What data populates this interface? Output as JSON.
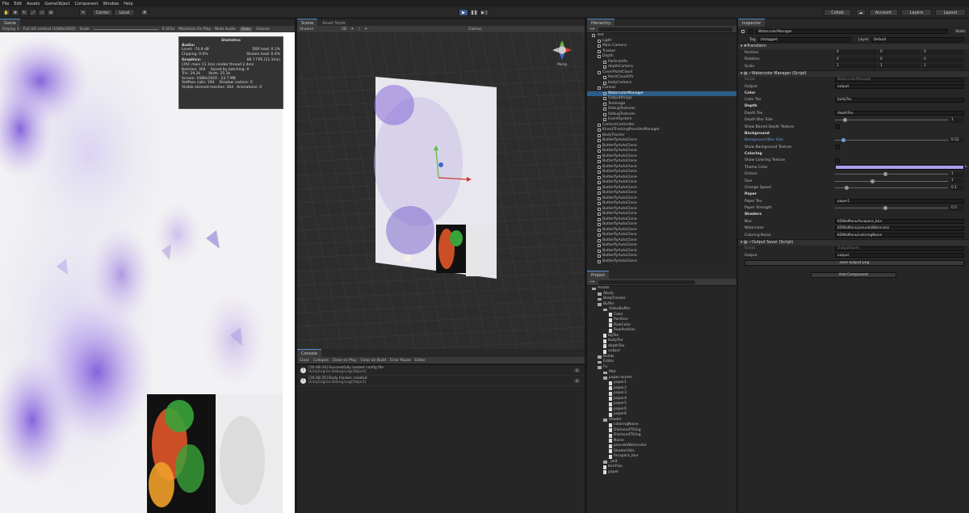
{
  "menu": [
    "File",
    "Edit",
    "Assets",
    "GameObject",
    "Component",
    "Window",
    "Help"
  ],
  "toolbar": {
    "pivot": "Center",
    "space": "Local",
    "collab": "Collab",
    "account": "Account",
    "layers": "Layers",
    "layout": "Layout"
  },
  "game": {
    "tab": "Game",
    "display": "Display 1",
    "res": "Full HD vertical (1080x1920)",
    "scale_label": "Scale",
    "scale_val": "0.355x",
    "max_label": "Maximize On Play",
    "mute_label": "Mute Audio",
    "stats_label": "Stats",
    "gizmos_label": "Gizmos"
  },
  "stats": {
    "title": "Statistics",
    "audio_h": "Audio:",
    "level": "Level: -74.8 dB",
    "clipping": "Clipping: 0.0%",
    "dsp": "DSP load: 0.1%",
    "stream": "Stream load: 0.0%",
    "graphics_h": "Graphics:",
    "fps": "89.7 FPS (11.1ms)",
    "cpu": "CPU: main 11.1ms  render thread 2.4ms",
    "batches": "Batches: 304",
    "saved": "Saved by batching: 0",
    "tris": "Tris: 29.2k",
    "verts": "Verts: 25.1k",
    "screen": "Screen: 1080x1920 - 23.7 MB",
    "setpass": "SetPass calls: 194",
    "shadow": "Shadow casters: 0",
    "skinned": "Visible skinned meshes: 304",
    "anims": "Animations: 0"
  },
  "scene": {
    "tab1": "Scene",
    "tab2": "Asset Store",
    "shaded": "Shaded",
    "mode": "2D",
    "gizmos": "Gizmos",
    "persp": "Persp"
  },
  "console": {
    "tab": "Console",
    "clear": "Clear",
    "collapse": "Collapse",
    "clear_on_play": "Clear on Play",
    "clear_on_build": "Clear on Build",
    "error_pause": "Error Pause",
    "editor": "Editor",
    "logs": [
      {
        "line1": "[16:48:33] Successfully loaded config file",
        "line2": "UnityEngine.Debug:Log(Object)",
        "count": "1"
      },
      {
        "line1": "[16:48:35] Body tracker created",
        "line2": "UnityEngine.Debug:Log(Object)",
        "count": "1"
      }
    ]
  },
  "hierarchy": {
    "tab": "Hierarchy",
    "items": [
      {
        "name": "Test",
        "indent": 0
      },
      {
        "name": "Light",
        "indent": 1
      },
      {
        "name": "Main Camera",
        "indent": 1
      },
      {
        "name": "Tracker",
        "indent": 1
      },
      {
        "name": "Depth",
        "indent": 1
      },
      {
        "name": "ParticleVfx",
        "indent": 2
      },
      {
        "name": "depthCamera",
        "indent": 2
      },
      {
        "name": "CoverPointCloud",
        "indent": 1
      },
      {
        "name": "PointCloudVfx",
        "indent": 2
      },
      {
        "name": "bodyCamera",
        "indent": 2
      },
      {
        "name": "Canvas",
        "indent": 1
      },
      {
        "name": "WatercolorManager",
        "indent": 2,
        "selected": true
      },
      {
        "name": "OutputImage",
        "indent": 2
      },
      {
        "name": "TexImage",
        "indent": 2
      },
      {
        "name": "DebugTextures",
        "indent": 2
      },
      {
        "name": "DebugTextures",
        "indent": 2
      },
      {
        "name": "EventSystem",
        "indent": 2
      },
      {
        "name": "CameraController",
        "indent": 1
      },
      {
        "name": "KinectTrackingProviderManager",
        "indent": 1
      },
      {
        "name": "BodyTracker",
        "indent": 1
      },
      {
        "name": "ButterflyAutoClone",
        "indent": 1
      },
      {
        "name": "ButterflyAutoClone",
        "indent": 1
      },
      {
        "name": "ButterflyAutoClone",
        "indent": 1
      },
      {
        "name": "ButterflyAutoClone",
        "indent": 1
      },
      {
        "name": "ButterflyAutoClone",
        "indent": 1
      },
      {
        "name": "ButterflyAutoClone",
        "indent": 1
      },
      {
        "name": "ButterflyAutoClone",
        "indent": 1
      },
      {
        "name": "ButterflyAutoClone",
        "indent": 1
      },
      {
        "name": "ButterflyAutoClone",
        "indent": 1
      },
      {
        "name": "ButterflyAutoClone",
        "indent": 1
      },
      {
        "name": "ButterflyAutoClone",
        "indent": 1
      },
      {
        "name": "ButterflyAutoClone",
        "indent": 1
      },
      {
        "name": "ButterflyAutoClone",
        "indent": 1
      },
      {
        "name": "ButterflyAutoClone",
        "indent": 1
      },
      {
        "name": "ButterflyAutoClone",
        "indent": 1
      },
      {
        "name": "ButterflyAutoClone",
        "indent": 1
      },
      {
        "name": "ButterflyAutoClone",
        "indent": 1
      },
      {
        "name": "ButterflyAutoClone",
        "indent": 1
      },
      {
        "name": "ButterflyAutoClone",
        "indent": 1
      },
      {
        "name": "ButterflyAutoClone",
        "indent": 1
      },
      {
        "name": "ButterflyAutoClone",
        "indent": 1
      },
      {
        "name": "ButterflyAutoClone",
        "indent": 1
      },
      {
        "name": "ButterflyAutoClone",
        "indent": 1
      },
      {
        "name": "ButterflyAutoClone",
        "indent": 1
      }
    ]
  },
  "project": {
    "tab": "Project",
    "items": [
      {
        "name": "Assets",
        "indent": 0,
        "kind": "folder"
      },
      {
        "name": "Abufy",
        "indent": 1,
        "kind": "folder"
      },
      {
        "name": "BodyTracker",
        "indent": 1,
        "kind": "folder"
      },
      {
        "name": "Buffer",
        "indent": 1,
        "kind": "folder"
      },
      {
        "name": "VideoBuffer",
        "indent": 2,
        "kind": "folder"
      },
      {
        "name": "Color",
        "indent": 3,
        "kind": "file"
      },
      {
        "name": "Position",
        "indent": 3,
        "kind": "file"
      },
      {
        "name": "RawColor",
        "indent": 3,
        "kind": "file"
      },
      {
        "name": "RawPosition",
        "indent": 3,
        "kind": "file"
      },
      {
        "name": "bgTex",
        "indent": 2,
        "kind": "file"
      },
      {
        "name": "bodyTex",
        "indent": 2,
        "kind": "file"
      },
      {
        "name": "depthTex",
        "indent": 2,
        "kind": "file"
      },
      {
        "name": "output",
        "indent": 2,
        "kind": "file"
      },
      {
        "name": "Builds",
        "indent": 1,
        "kind": "folder"
      },
      {
        "name": "Editor",
        "indent": 1,
        "kind": "folder"
      },
      {
        "name": "Fx",
        "indent": 1,
        "kind": "folder"
      },
      {
        "name": "Mat",
        "indent": 2,
        "kind": "folder"
      },
      {
        "name": "paper-assets",
        "indent": 2,
        "kind": "folder"
      },
      {
        "name": "paper1",
        "indent": 3,
        "kind": "file"
      },
      {
        "name": "paper2",
        "indent": 3,
        "kind": "file"
      },
      {
        "name": "paper3",
        "indent": 3,
        "kind": "file"
      },
      {
        "name": "paper4",
        "indent": 3,
        "kind": "file"
      },
      {
        "name": "paper5",
        "indent": 3,
        "kind": "file"
      },
      {
        "name": "paper6",
        "indent": 3,
        "kind": "file"
      },
      {
        "name": "paper6",
        "indent": 3,
        "kind": "file"
      },
      {
        "name": "Shader",
        "indent": 2,
        "kind": "folder"
      },
      {
        "name": "coloringNoise",
        "indent": 3,
        "kind": "file"
      },
      {
        "name": "DiamondTilling",
        "indent": 3,
        "kind": "file"
      },
      {
        "name": "DiamondTilling",
        "indent": 3,
        "kind": "file"
      },
      {
        "name": "Noise",
        "indent": 3,
        "kind": "file"
      },
      {
        "name": "pseudoWatercolor",
        "indent": 3,
        "kind": "file"
      },
      {
        "name": "ShaderUtils",
        "indent": 3,
        "kind": "file"
      },
      {
        "name": "fecapara_blur",
        "indent": 3,
        "kind": "file"
      },
      {
        "name": "_ukit",
        "indent": 2,
        "kind": "folder"
      },
      {
        "name": "benFlex",
        "indent": 2,
        "kind": "file"
      },
      {
        "name": "paper",
        "indent": 2,
        "kind": "file"
      }
    ]
  },
  "inspector": {
    "tab": "Inspector",
    "object_name": "WatercolorManager",
    "static": "Static",
    "tag_label": "Tag",
    "tag": "Untagged",
    "layer_label": "Layer",
    "layer": "Default",
    "transform": {
      "title": "Transform",
      "position": "Position",
      "rotation": "Rotation",
      "scale": "Scale",
      "px": "0",
      "py": "0",
      "pz": "0",
      "rx": "0",
      "ry": "0",
      "rz": "0",
      "sx": "1",
      "sy": "1",
      "sz": "1"
    },
    "wm": {
      "title": "Watercolor Manager (Script)",
      "script_label": "Script",
      "script": "WatercolorManager",
      "output_label": "Output",
      "output": "output",
      "color_h": "Color",
      "color_tex_label": "Color Tex",
      "color_tex": "bodyTex",
      "depth_h": "Depth",
      "depth_tex_label": "Depth Tex",
      "depth_tex": "depthTex",
      "depth_blur_label": "Depth Blur Size",
      "depth_blur": "1",
      "show_depth_label": "Show Blured Depth Texture",
      "bg_h": "Background",
      "bg_blur_label": "Background Blur Size",
      "bg_blur": "0.52",
      "show_bg_label": "Show Background Texture",
      "coloring_h": "Coloring",
      "show_coloring_label": "Show Coloring Texture",
      "theme_color_label": "Theme Color",
      "theme_color": "#a99ef0",
      "octave_label": "Octave",
      "octave": "1",
      "size_label": "Size",
      "size": "1",
      "change_speed_label": "Change Speed",
      "change_speed": "0.1",
      "paper_h": "Paper",
      "paper_tex_label": "Paper Tex",
      "paper_tex": "paper1",
      "paper_strength_label": "Paper Strength",
      "paper_strength": "0.5",
      "shaders_h": "Shaders",
      "blur_label": "Blur",
      "blur": "KDWaManu/fecapara_blur",
      "watercolor_label": "Watercolor",
      "watercolor": "KDWaManu/pseudoWatercolor",
      "coloring_noise_label": "Coloring Noise",
      "coloring_noise": "KDWaManu/coloringNoise"
    },
    "os": {
      "title": "Output Saver (Script)",
      "script_label": "Script",
      "script": "OutputSaver",
      "output_label": "Output",
      "output": "output",
      "save_btn": "save output png"
    },
    "add_component": "Add Component"
  }
}
